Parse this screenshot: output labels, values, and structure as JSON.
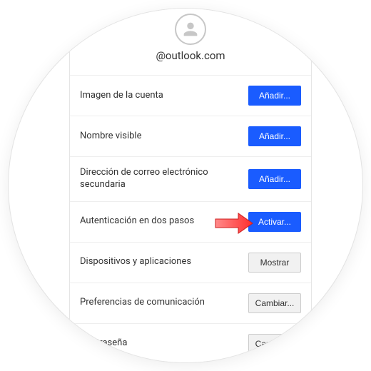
{
  "header": {
    "email": "@outlook.com"
  },
  "rows": [
    {
      "label": "Imagen de la cuenta",
      "button": "Añadir...",
      "variant": "primary"
    },
    {
      "label": "Nombre visible",
      "button": "Añadir...",
      "variant": "primary"
    },
    {
      "label": "Dirección de correo electrónico secundaria",
      "button": "Añadir...",
      "variant": "primary"
    },
    {
      "label": "Autenticación en dos pasos",
      "button": "Activar...",
      "variant": "primary"
    },
    {
      "label": "Dispositivos y aplicaciones",
      "button": "Mostrar",
      "variant": "default"
    },
    {
      "label": "Preferencias de comunicación",
      "button": "Cambiar...",
      "variant": "default"
    },
    {
      "label": "Contraseña",
      "button": "Cambiar...",
      "variant": "default"
    }
  ]
}
